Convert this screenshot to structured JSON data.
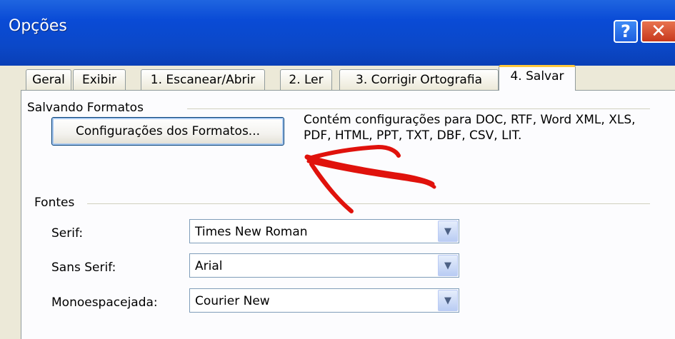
{
  "window": {
    "title": "Opções",
    "help_icon": "help-icon",
    "close_icon": "close-icon",
    "help_glyph": "?",
    "close_glyph": "✕"
  },
  "tabs": [
    {
      "label": "Geral"
    },
    {
      "label": "Exibir"
    },
    {
      "label": "1. Escanear/Abrir"
    },
    {
      "label": "2. Ler"
    },
    {
      "label": "3. Corrigir Ortografia"
    },
    {
      "label": "4. Salvar",
      "active": true
    }
  ],
  "formats": {
    "group_label": "Salvando Formatos",
    "button_label": "Configurações dos Formatos...",
    "description": "Contém configurações para DOC, RTF, Word XML, XLS, PDF, HTML, PPT, TXT, DBF, CSV, LIT."
  },
  "fonts": {
    "group_label": "Fontes",
    "fields": [
      {
        "label": "Serif:",
        "value": "Times New Roman"
      },
      {
        "label": "Sans Serif:",
        "value": "Arial"
      },
      {
        "label": "Monoespacejada:",
        "value": "Courier New"
      }
    ]
  },
  "annotation": {
    "color": "#e0120c",
    "description_icon": "red-hand-drawn-arrow"
  },
  "colors": {
    "titlebar": "#0a4bd6",
    "dialog_bg": "#ece9d8",
    "active_tab_accent": "#ffc83c"
  }
}
